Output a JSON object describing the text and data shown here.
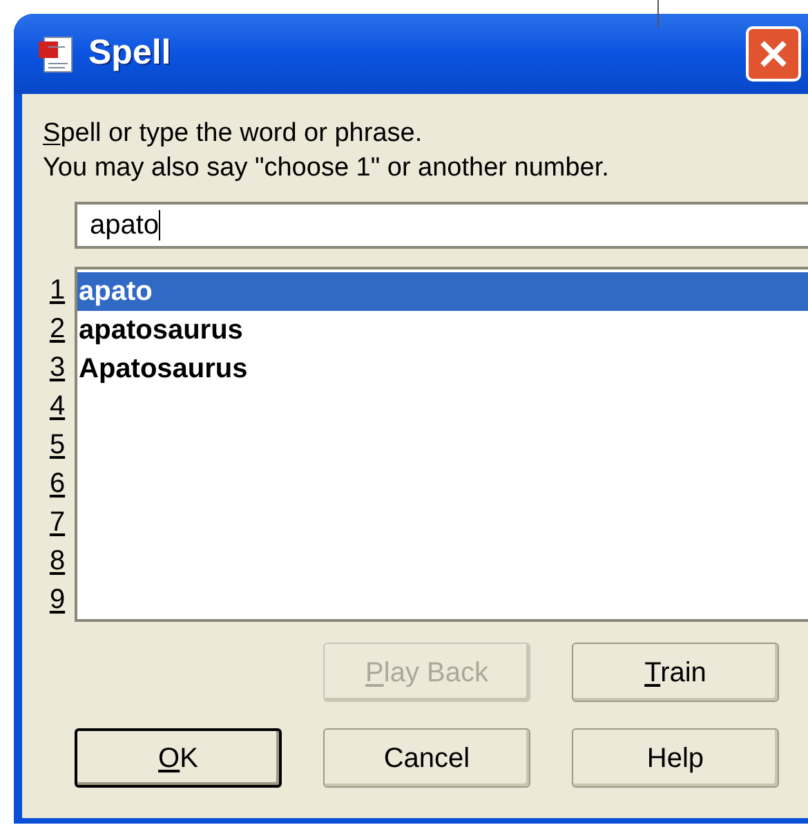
{
  "window": {
    "title": "Spell"
  },
  "instructions": [
    "Spell or type the word or phrase.",
    "You may also say \"choose 1\" or another number."
  ],
  "instructions_mnemonic": true,
  "input": {
    "value": "apato"
  },
  "list": {
    "numbers": [
      "1",
      "2",
      "3",
      "4",
      "5",
      "6",
      "7",
      "8",
      "9"
    ],
    "items": [
      {
        "label": "apato",
        "selected": true
      },
      {
        "label": "apatosaurus",
        "selected": false
      },
      {
        "label": "Apatosaurus",
        "selected": false
      }
    ]
  },
  "buttons": [
    {
      "label": "Play Back",
      "disabled": true,
      "default": false,
      "mnemonic": true
    },
    {
      "label": "Train",
      "disabled": false,
      "default": false,
      "mnemonic": true
    },
    {
      "label": "OK",
      "disabled": false,
      "default": true,
      "mnemonic": true
    },
    {
      "label": "Cancel",
      "disabled": false,
      "default": false,
      "mnemonic": false
    },
    {
      "label": "Help",
      "disabled": false,
      "default": false,
      "mnemonic": false
    }
  ]
}
